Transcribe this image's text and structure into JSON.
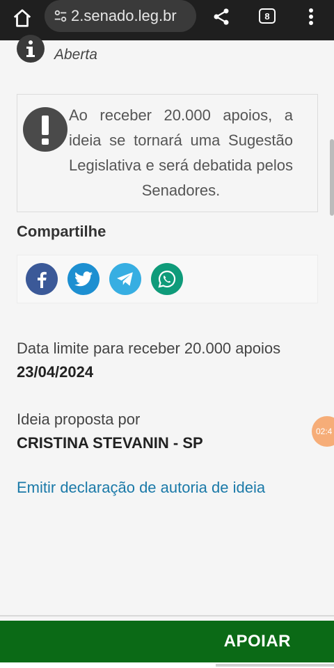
{
  "browser": {
    "url": "2.senado.leg.br",
    "tab_count": "8"
  },
  "idea": {
    "status": "Aberta",
    "notice": "Ao receber 20.000 apoios, a ideia se tornará uma Sugestão Legislativa e será debatida pelos Senadores.",
    "share_title": "Compartilhe",
    "share_buttons": [
      {
        "name": "facebook",
        "color": "#3b5998"
      },
      {
        "name": "twitter",
        "color": "#1d8fd1"
      },
      {
        "name": "telegram",
        "color": "#37aee2"
      },
      {
        "name": "whatsapp",
        "color": "#0f9b7a"
      }
    ],
    "deadline_label": "Data limite para receber 20.000 apoios",
    "deadline_value": "23/04/2024",
    "author_label": "Ideia proposta por",
    "author_value": "CRISTINA STEVANIN - SP",
    "declaration_link": "Emitir declaração de autoria de ideia",
    "support_button": "APOIAR"
  },
  "overlay": {
    "timer": "02:4"
  },
  "colors": {
    "link": "#1a79a8",
    "support_bar": "#0b6a16",
    "timer": "#f6ad78"
  }
}
